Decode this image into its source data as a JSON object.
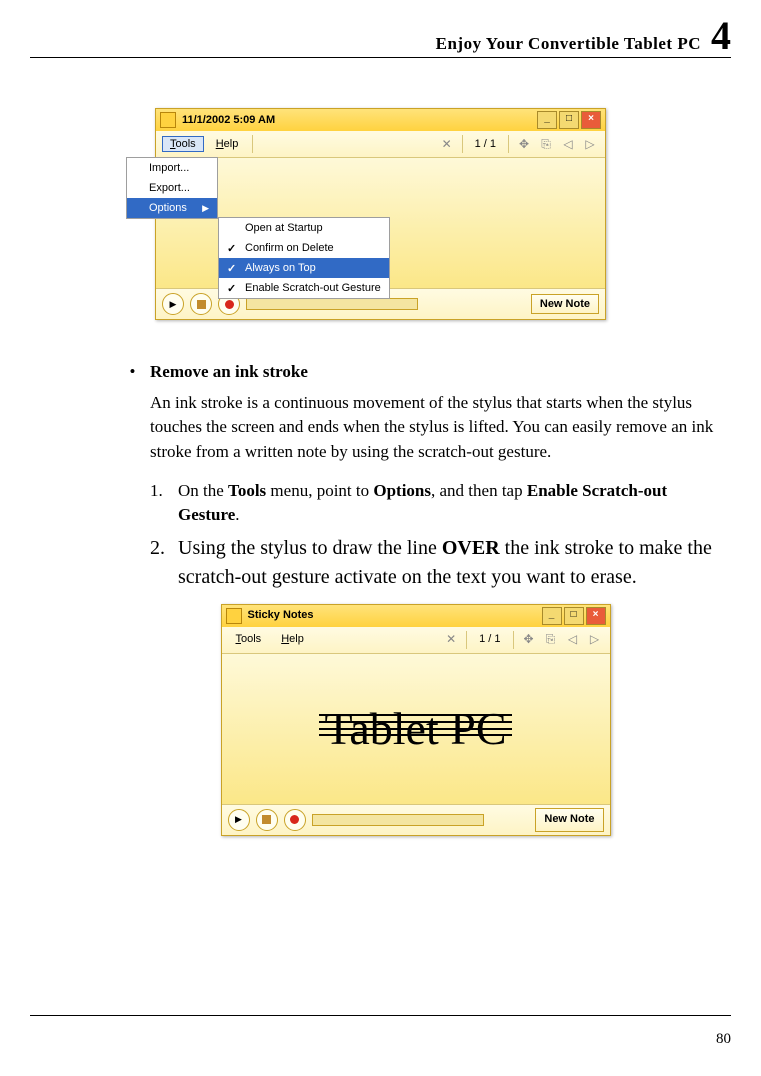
{
  "header": {
    "title": "Enjoy Your Convertible Tablet PC",
    "chapter": "4"
  },
  "window1": {
    "title": "11/1/2002 5:09 AM",
    "menu_tools": "Tools",
    "menu_help": "Help",
    "page_ind": "1 / 1",
    "tools_menu": {
      "import": "Import...",
      "export": "Export...",
      "options": "Options"
    },
    "options_menu": {
      "open_startup": "Open at Startup",
      "confirm_delete": "Confirm on Delete",
      "always_top": "Always on Top",
      "scratch_out": "Enable Scratch-out Gesture"
    },
    "new_note": "New Note"
  },
  "body": {
    "heading": "Remove an ink stroke",
    "para1": "An ink stroke is a continuous movement of the stylus that starts when the stylus touches the screen and ends when the stylus is lifted. You can easily remove an ink stroke from a written note by using the scratch-out gesture.",
    "step1_a": "On the ",
    "step1_b": "Tools",
    "step1_c": " menu, point to ",
    "step1_d": "Options",
    "step1_e": ", and then tap ",
    "step1_f": "Enable Scratch-out Gesture",
    "step1_g": ".",
    "step2_a": "Using the stylus to draw the line ",
    "step2_b": "OVER",
    "step2_c": " the ink stroke to make the scratch-out gesture activate on the text you want to erase."
  },
  "window2": {
    "title": "Sticky Notes",
    "menu_tools": "Tools",
    "menu_help": "Help",
    "page_ind": "1 / 1",
    "handwriting": "Tablet PC",
    "new_note": "New Note"
  },
  "page_number": "80"
}
